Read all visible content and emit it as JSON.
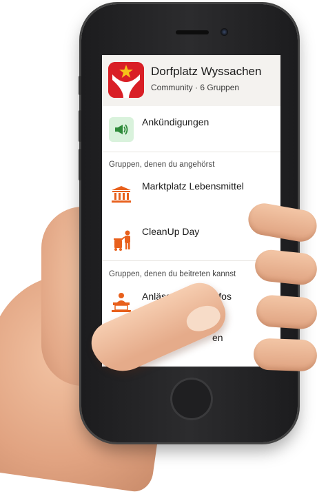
{
  "app": {
    "title": "Dorfplatz Wyssachen",
    "subtitle": "Community · 6 Gruppen"
  },
  "announcements": {
    "label": "Ankündigungen",
    "icon": "megaphone-icon"
  },
  "member_groups": {
    "section_label": "Gruppen, denen du angehörst",
    "items": [
      {
        "label": "Marktplatz Lebensmittel",
        "icon": "market-building-icon"
      },
      {
        "label": "CleanUp Day",
        "icon": "cleanup-person-icon"
      }
    ]
  },
  "joinable_groups": {
    "section_label": "Gruppen, denen du beitreten kannst",
    "items": [
      {
        "label": "Anlässe/Vereinsinfos",
        "icon": "meeting-table-icon"
      },
      {
        "label": "en",
        "icon": "group-icon"
      }
    ]
  },
  "colors": {
    "brand_red": "#d91f26",
    "accent_orange": "#e8601c",
    "header_bg": "#f4f2ef",
    "announce_bg": "#d9f2dc",
    "announce_green": "#2e8b3a"
  }
}
